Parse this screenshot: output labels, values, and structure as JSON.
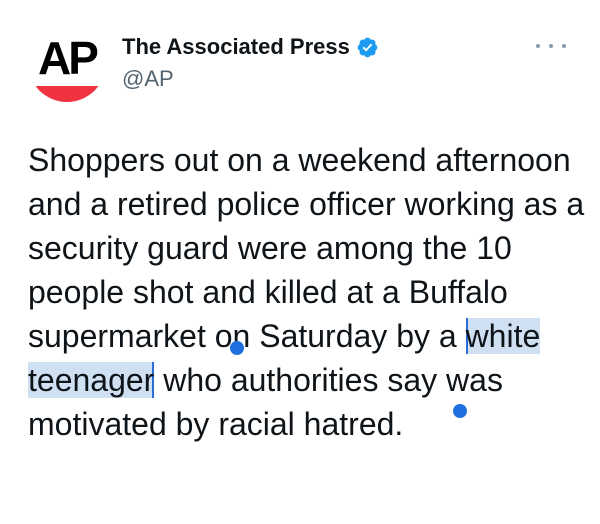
{
  "account": {
    "logo_text": "AP",
    "display_name": "The Associated Press",
    "handle": "@AP",
    "verified": true,
    "brand_red": "#ef3340",
    "verified_color": "#1d9bf0"
  },
  "tweet": {
    "text_before": "Shoppers out on a weekend afternoon and a retired police officer working as a security guard were among the 10 people shot and killed at a Buffalo supermarket on Saturday by a ",
    "text_selected": "white teenager",
    "text_after": " who authorities say was motivated by racial hatred."
  },
  "icons": {
    "more": "more-horizontal-icon",
    "verified": "verified-badge-icon"
  },
  "selection": {
    "highlight_color": "#cfe0f3",
    "handle_color": "#1f6fe0"
  }
}
